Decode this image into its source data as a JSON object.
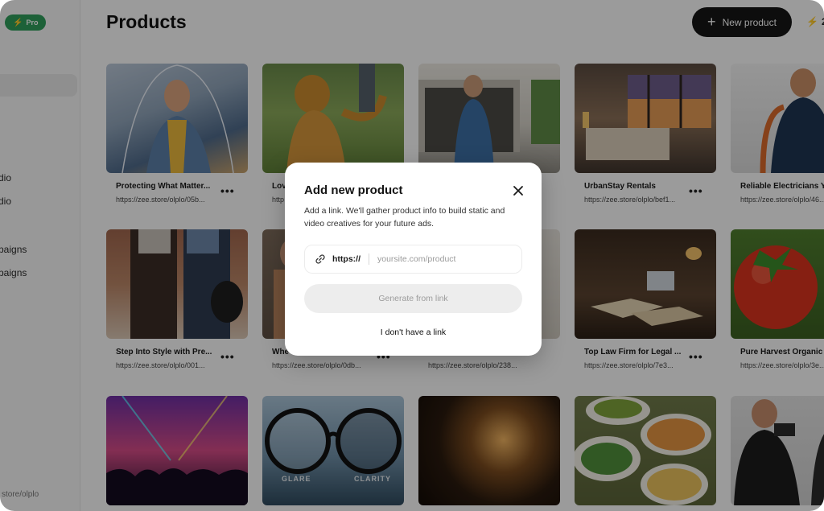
{
  "sidebar": {
    "plan_badge": "Pro",
    "items": [
      "dio",
      "dio",
      "paigns",
      "paigns"
    ],
    "footer_url": "store/olplo"
  },
  "header": {
    "title": "Products",
    "new_product_label": "New product",
    "credits_value": "2"
  },
  "products": [
    {
      "title": "Protecting What Matter...",
      "url": "https://zee.store/olplo/05b..."
    },
    {
      "title": "Lov",
      "url": "http"
    },
    {
      "title": "",
      "url": ""
    },
    {
      "title": "UrbanStay Rentals",
      "url": "https://zee.store/olplo/bef1..."
    },
    {
      "title": "Reliable Electricians Y",
      "url": "https://zee.store/olplo/46..."
    },
    {
      "title": "Step Into Style with Pre...",
      "url": "https://zee.store/olplo/001..."
    },
    {
      "title": "Whe",
      "url": "https://zee.store/olplo/0db..."
    },
    {
      "title": "",
      "url": "https://zee.store/olplo/238..."
    },
    {
      "title": "Top Law Firm for Legal ...",
      "url": "https://zee.store/olplo/7e3..."
    },
    {
      "title": "Pure Harvest Organic",
      "url": "https://zee.store/olplo/3e..."
    },
    {
      "title": "",
      "url": ""
    },
    {
      "title": "",
      "url": ""
    },
    {
      "title": "",
      "url": ""
    },
    {
      "title": "",
      "url": ""
    },
    {
      "title": "",
      "url": ""
    }
  ],
  "thumb_labels": {
    "glare": "GLARE",
    "clarity": "CLARITY"
  },
  "modal": {
    "title": "Add new product",
    "description": "Add a link. We'll gather product info to build static and video creatives for your future ads.",
    "url_prefix": "https://",
    "url_placeholder": "yoursite.com/product",
    "url_value": "",
    "generate_label": "Generate from link",
    "no_link_label": "I don't have a link"
  },
  "icons": {
    "plan_badge": "bolt-icon",
    "credits": "bolt-icon",
    "new_product": "plus-icon",
    "card_menu": "more-horizontal-icon",
    "modal_close": "close-icon",
    "url_field": "link-icon"
  },
  "colors": {
    "accent_green": "#2f9d5b",
    "primary_button": "#151515",
    "overlay": "rgba(0,0,0,0.38)"
  }
}
